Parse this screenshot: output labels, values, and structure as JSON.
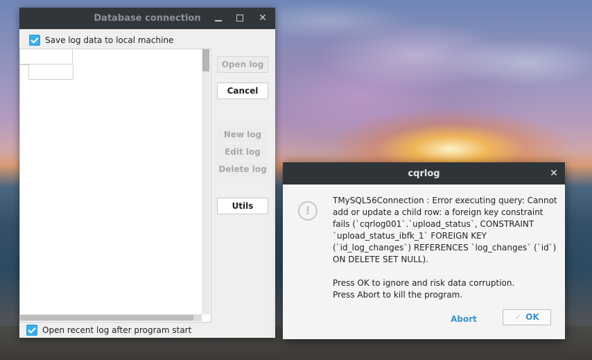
{
  "db_window": {
    "title": "Database connection",
    "save_log_label": "Save log data to local machine",
    "save_log_checked": true,
    "open_recent_label": "Open recent log after program start",
    "open_recent_checked": true,
    "buttons": {
      "open_log": "Open log",
      "cancel": "Cancel",
      "new_log": "New log",
      "edit_log": "Edit log",
      "delete_log": "Delete log",
      "utils": "Utils"
    }
  },
  "dialog": {
    "title": "cqrlog",
    "message": "TMySQL56Connection : Error executing query: Cannot add or update a child row: a foreign key constraint fails (`cqrlog001`.`upload_status`, CONSTRAINT `upload_status_ibfk_1` FOREIGN KEY (`id_log_changes`) REFERENCES `log_changes` (`id`) ON DELETE SET NULL).\n\nPress OK to ignore and risk data corruption.\nPress Abort to kill the program.",
    "abort_label": "Abort",
    "ok_label": "OK",
    "icon": "warning-icon"
  },
  "colors": {
    "titlebar": "#31363b",
    "accent": "#3daee9",
    "link": "#3a92c9"
  }
}
